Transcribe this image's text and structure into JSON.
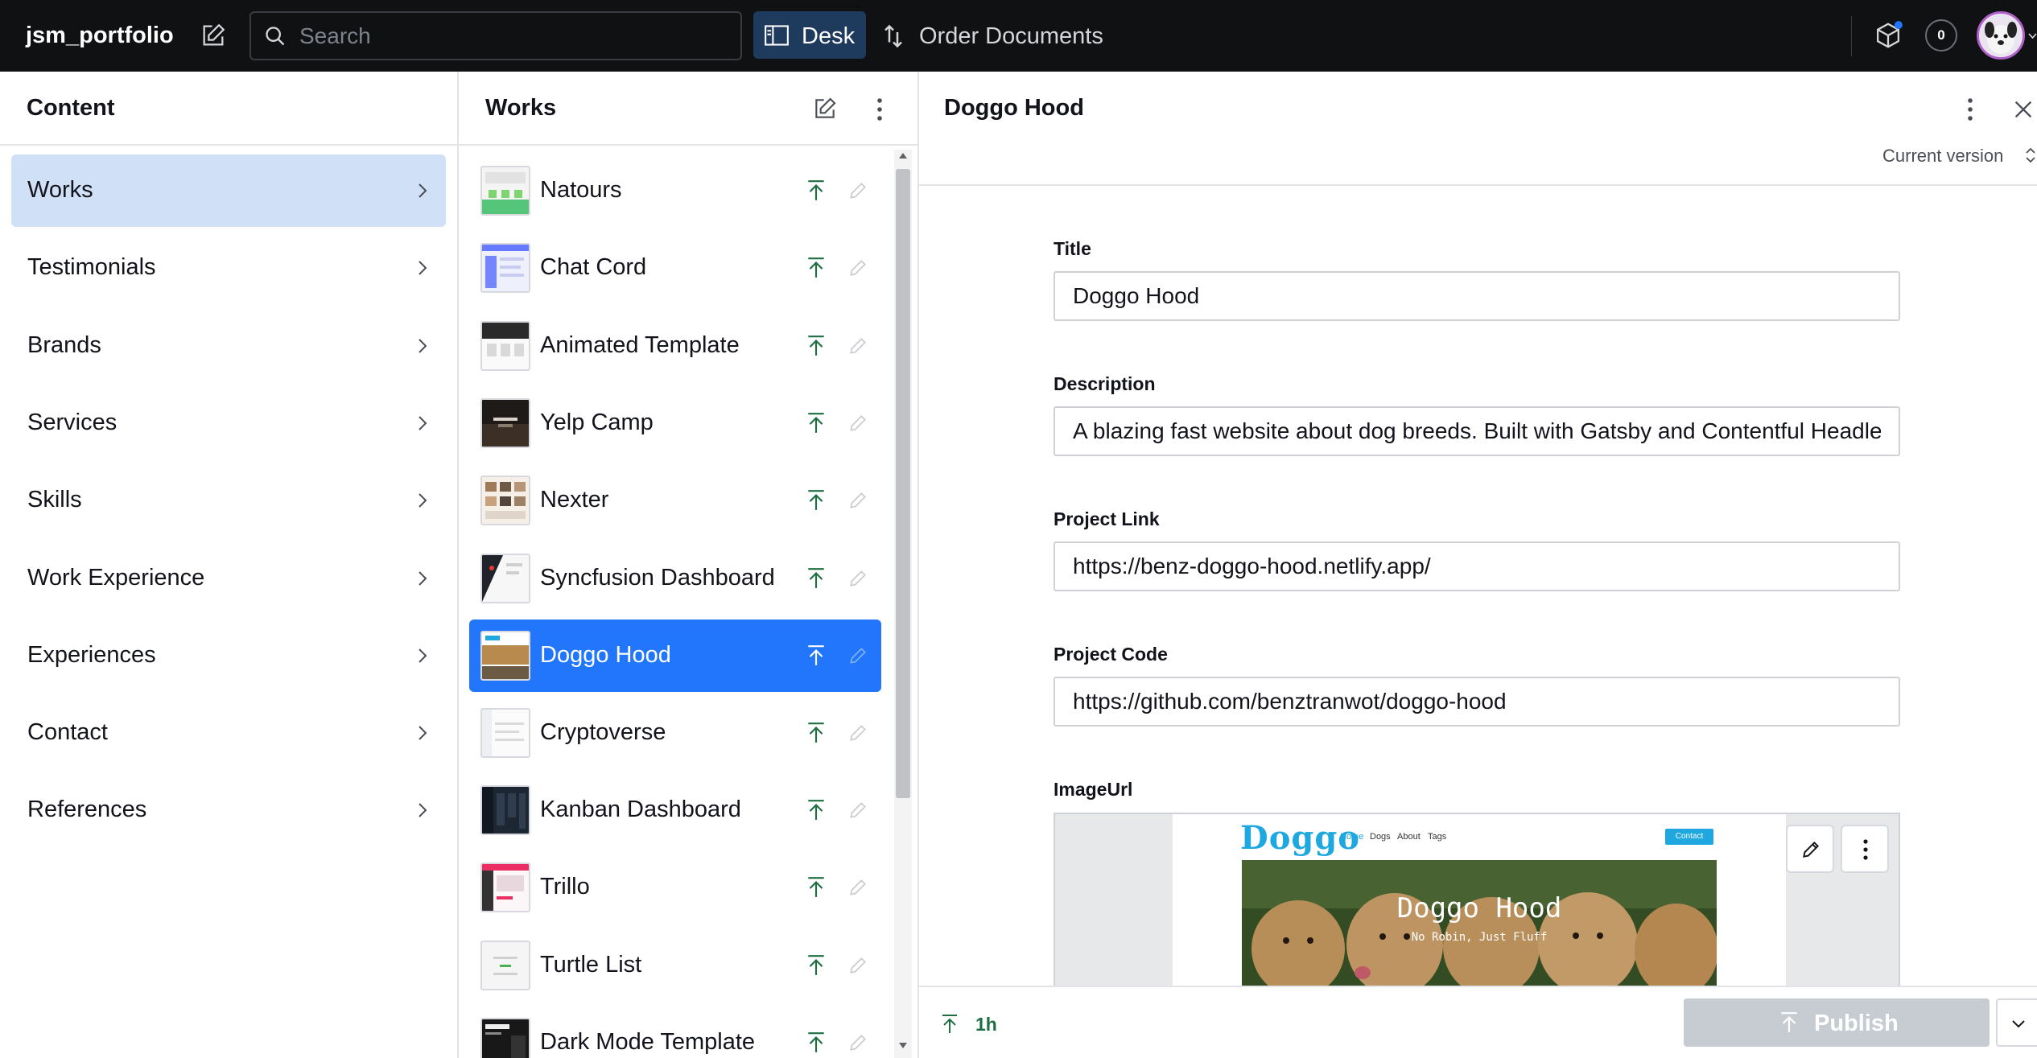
{
  "topbar": {
    "brand": "jsm_portfolio",
    "search_placeholder": "Search",
    "desk_label": "Desk",
    "order_label": "Order Documents",
    "notification_count": "0"
  },
  "content_pane": {
    "title": "Content",
    "items": [
      {
        "label": "Works",
        "active": true
      },
      {
        "label": "Testimonials"
      },
      {
        "label": "Brands"
      },
      {
        "label": "Services"
      },
      {
        "label": "Skills"
      },
      {
        "label": "Work Experience"
      },
      {
        "label": "Experiences"
      },
      {
        "label": "Contact"
      },
      {
        "label": "References"
      }
    ]
  },
  "works_pane": {
    "title": "Works",
    "items": [
      {
        "label": "Natours"
      },
      {
        "label": "Chat Cord"
      },
      {
        "label": "Animated Template"
      },
      {
        "label": "Yelp Camp"
      },
      {
        "label": "Nexter"
      },
      {
        "label": "Syncfusion Dashboard"
      },
      {
        "label": "Doggo Hood",
        "active": true
      },
      {
        "label": "Cryptoverse"
      },
      {
        "label": "Kanban Dashboard"
      },
      {
        "label": "Trillo"
      },
      {
        "label": "Turtle List"
      },
      {
        "label": "Dark Mode Template"
      }
    ]
  },
  "document": {
    "title": "Doggo Hood",
    "version_label": "Current version",
    "fields": {
      "title_label": "Title",
      "title_value": "Doggo Hood",
      "description_label": "Description",
      "description_value": "A blazing fast website about dog breeds. Built with Gatsby and Contentful Headless CMS",
      "project_link_label": "Project Link",
      "project_link_value": "https://benz-doggo-hood.netlify.app/",
      "project_code_label": "Project Code",
      "project_code_value": "https://github.com/benztranwot/doggo-hood",
      "image_label": "ImageUrl"
    },
    "image_preview": {
      "logo": "Doggo",
      "nav": [
        "Home",
        "Dogs",
        "About",
        "Tags"
      ],
      "contact": "Contact",
      "hero_title": "Doggo Hood",
      "hero_subtitle": "No Robin, Just Fluff"
    },
    "footer": {
      "published_ago": "1h",
      "publish_label": "Publish"
    }
  },
  "colors": {
    "topbar_bg": "#101112",
    "active_item_bg": "#2276fc",
    "content_active_bg": "#cfe0f7",
    "published_green": "#1d6f42",
    "publish_disabled": "#c7ccd3"
  }
}
